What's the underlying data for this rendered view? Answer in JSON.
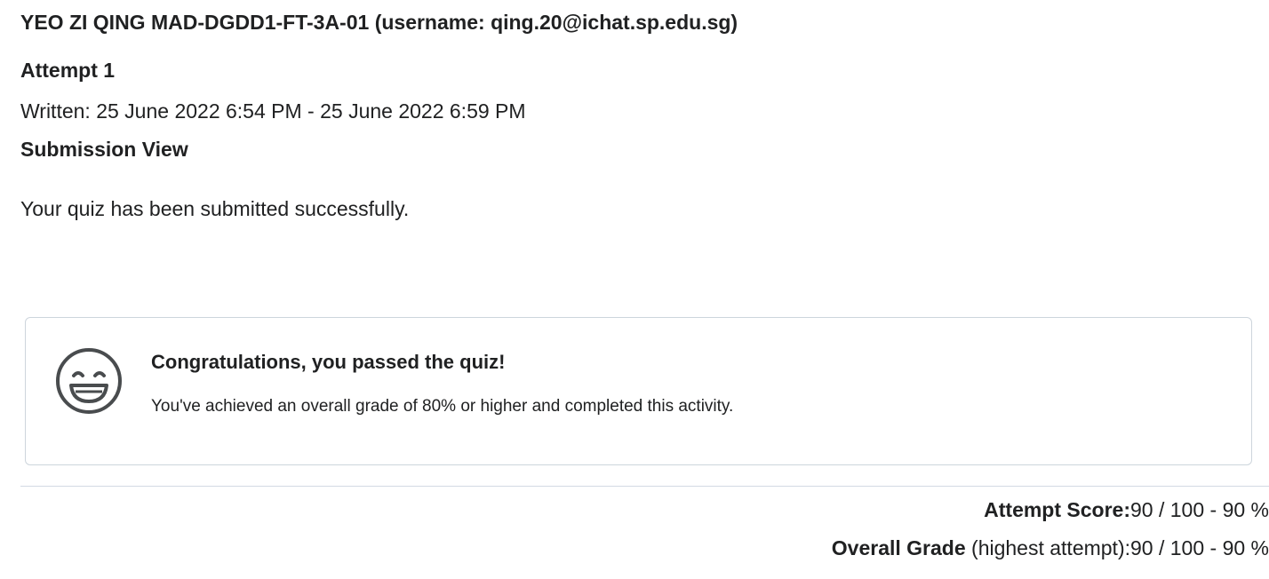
{
  "header": {
    "user_heading": "YEO ZI QING MAD-DGDD1-FT-3A-01 (username: qing.20@ichat.sp.edu.sg)",
    "attempt_title": "Attempt 1",
    "written": "Written: 25 June 2022 6:54 PM - 25 June 2022 6:59 PM",
    "submission_view": "Submission View"
  },
  "message": {
    "submitted": "Your quiz has been submitted successfully."
  },
  "pass_card": {
    "icon": "smiley-face-icon",
    "title": "Congratulations, you passed the quiz!",
    "detail": "You've achieved an overall grade of 80% or higher and completed this activity."
  },
  "scores": {
    "attempt_label": "Attempt Score:",
    "attempt_value": "90 / 100 - 90 %",
    "overall_label": "Overall Grade",
    "overall_sub": " (highest attempt):",
    "overall_value": "90 / 100 - 90 %"
  },
  "colors": {
    "text": "#202122",
    "card_border": "#cdd5dc",
    "icon_stroke": "#494c4e"
  }
}
